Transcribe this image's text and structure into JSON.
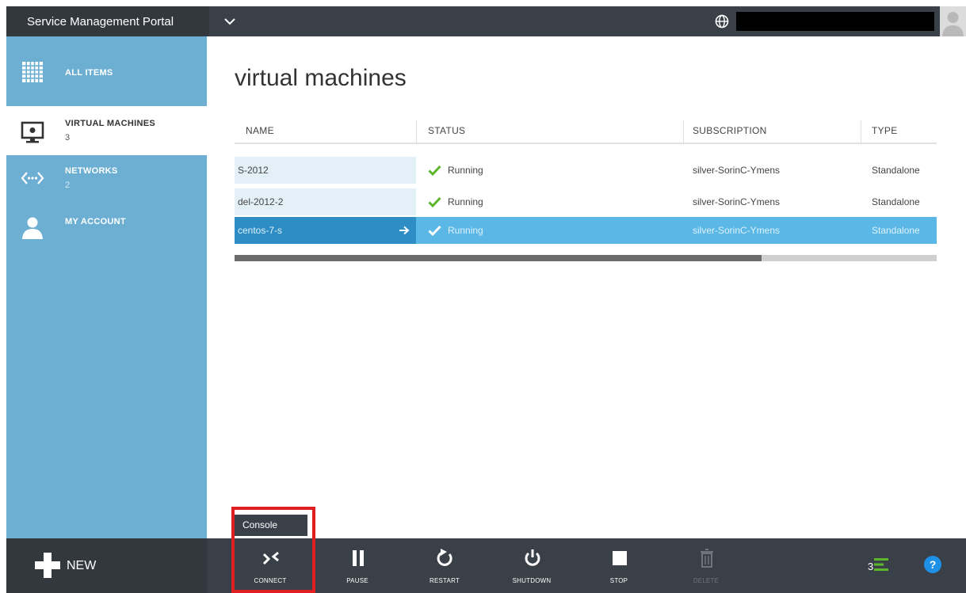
{
  "header": {
    "title": "Service Management Portal"
  },
  "sidebar": {
    "items": [
      {
        "label": "ALL ITEMS",
        "count": "",
        "icon": "grid-icon"
      },
      {
        "label": "VIRTUAL MACHINES",
        "count": "3",
        "icon": "monitor-icon"
      },
      {
        "label": "NETWORKS",
        "count": "2",
        "icon": "network-icon"
      },
      {
        "label": "MY ACCOUNT",
        "count": "",
        "icon": "user-icon"
      }
    ]
  },
  "main": {
    "title": "virtual machines",
    "columns": [
      "NAME",
      "STATUS",
      "SUBSCRIPTION",
      "TYPE"
    ],
    "rows": [
      {
        "name": "S-2012",
        "status": "Running",
        "subscription": "silver-SorinC-Ymens",
        "type": "Standalone"
      },
      {
        "name": "del-2012-2",
        "status": "Running",
        "subscription": "silver-SorinC-Ymens",
        "type": "Standalone"
      },
      {
        "name": "centos-7-s",
        "status": "Running",
        "subscription": "silver-SorinC-Ymens",
        "type": "Standalone"
      }
    ],
    "selected_row": 2,
    "scroll_position": 0.75
  },
  "bottombar": {
    "new_label": "NEW",
    "tooltip": "Console",
    "commands": [
      {
        "label": "CONNECT",
        "icon": "connect-icon",
        "enabled": true
      },
      {
        "label": "PAUSE",
        "icon": "pause-icon",
        "enabled": true
      },
      {
        "label": "RESTART",
        "icon": "restart-icon",
        "enabled": true
      },
      {
        "label": "SHUTDOWN",
        "icon": "power-icon",
        "enabled": true
      },
      {
        "label": "STOP",
        "icon": "stop-icon",
        "enabled": true
      },
      {
        "label": "DELETE",
        "icon": "trash-icon",
        "enabled": false
      }
    ],
    "notification_count": "3",
    "help_symbol": "?"
  },
  "colors": {
    "accent": "#6cafd3",
    "selected_row": "#5ab7e6",
    "bar": "#3a4048",
    "status_ok": "#5cb82a",
    "highlight": "#e02020"
  }
}
